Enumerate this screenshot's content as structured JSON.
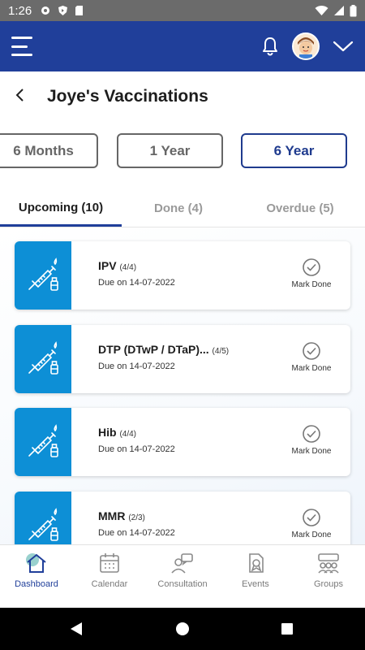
{
  "status_bar": {
    "time": "1:26"
  },
  "app_bar": {
    "menu_icon": "hamburger-icon",
    "bell_icon": "bell-icon",
    "avatar_icon": "avatar",
    "dropdown_icon": "chevron-down-icon"
  },
  "header": {
    "title": "Joye's Vaccinations",
    "back_icon": "back-arrow-icon"
  },
  "age_filters": [
    {
      "label": "6 Months",
      "active": false
    },
    {
      "label": "1 Year",
      "active": false
    },
    {
      "label": "6 Year",
      "active": true
    }
  ],
  "tabs": [
    {
      "label": "Upcoming (10)",
      "active": true
    },
    {
      "label": "Done (4)",
      "active": false
    },
    {
      "label": "Overdue (5)",
      "active": false
    }
  ],
  "vaccines": [
    {
      "name": "IPV",
      "dose": "(4/4)",
      "due": "Due on 14-07-2022",
      "action": "Mark Done"
    },
    {
      "name": "DTP (DTwP / DTaP)...",
      "dose": "(4/5)",
      "due": "Due on 14-07-2022",
      "action": "Mark Done"
    },
    {
      "name": "Hib",
      "dose": "(4/4)",
      "due": "Due on 14-07-2022",
      "action": "Mark Done"
    },
    {
      "name": "MMR",
      "dose": "(2/3)",
      "due": "Due on 14-07-2022",
      "action": "Mark Done"
    }
  ],
  "bottom_nav": [
    {
      "label": "Dashboard",
      "icon": "home-icon",
      "active": true
    },
    {
      "label": "Calendar",
      "icon": "calendar-icon",
      "active": false
    },
    {
      "label": "Consultation",
      "icon": "consultation-icon",
      "active": false
    },
    {
      "label": "Events",
      "icon": "events-icon",
      "active": false
    },
    {
      "label": "Groups",
      "icon": "groups-icon",
      "active": false
    }
  ],
  "colors": {
    "primary": "#203f9a",
    "accent_blue": "#0d8fd6",
    "status_bar": "#6b6b6b"
  }
}
